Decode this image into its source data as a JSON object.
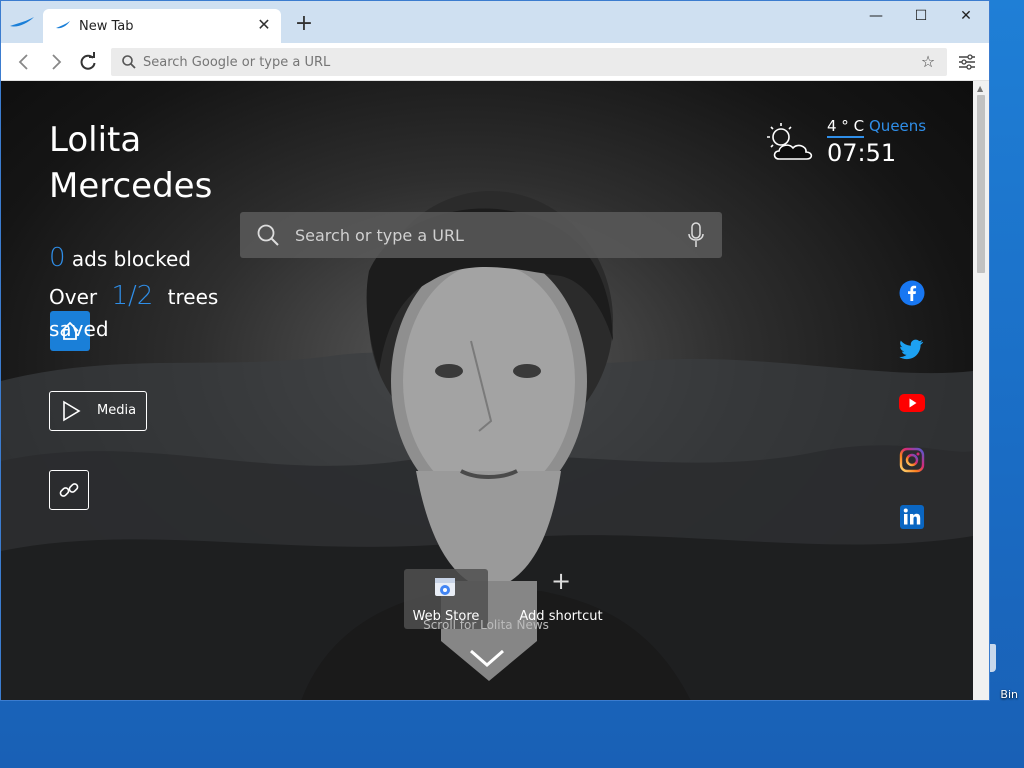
{
  "browser": {
    "tab_title": "New Tab",
    "new_tab_symbol": "+",
    "close_tab_symbol": "✕",
    "omnibox_placeholder": "Search Google or type a URL",
    "window_controls": {
      "minimize": "—",
      "maximize": "☐",
      "close": "✕"
    }
  },
  "page": {
    "user_name_line1": "Lolita",
    "user_name_line2": "Mercedes",
    "ads_blocked_count": "0",
    "ads_blocked_label": "ads blocked",
    "trees_prefix": "Over",
    "trees_count": "1/2",
    "trees_label": "trees",
    "trees_label2": "saved",
    "search_placeholder": "Search or type a URL",
    "media_label": "Media",
    "weather": {
      "temperature": "4 ° C",
      "city": "Queens",
      "time": "07:51"
    },
    "social_icons": [
      "facebook-icon",
      "twitter-icon",
      "youtube-icon",
      "instagram-icon",
      "linkedin-icon"
    ],
    "shortcuts": [
      {
        "label": "Web Store",
        "icon": "webstore-icon"
      },
      {
        "label": "Add shortcut",
        "icon": "plus-icon"
      }
    ],
    "scroll_news": "Scroll for Lolita News"
  },
  "desktop": {
    "recycle_bin_label": "Bin"
  },
  "colors": {
    "accent": "#2f8ee8",
    "tabbar": "#cfe0f1",
    "home_button": "#1a7fd8",
    "youtube": "#ff0000",
    "facebook": "#1877f2",
    "twitter": "#1da1f2",
    "linkedin": "#0a66c2"
  }
}
